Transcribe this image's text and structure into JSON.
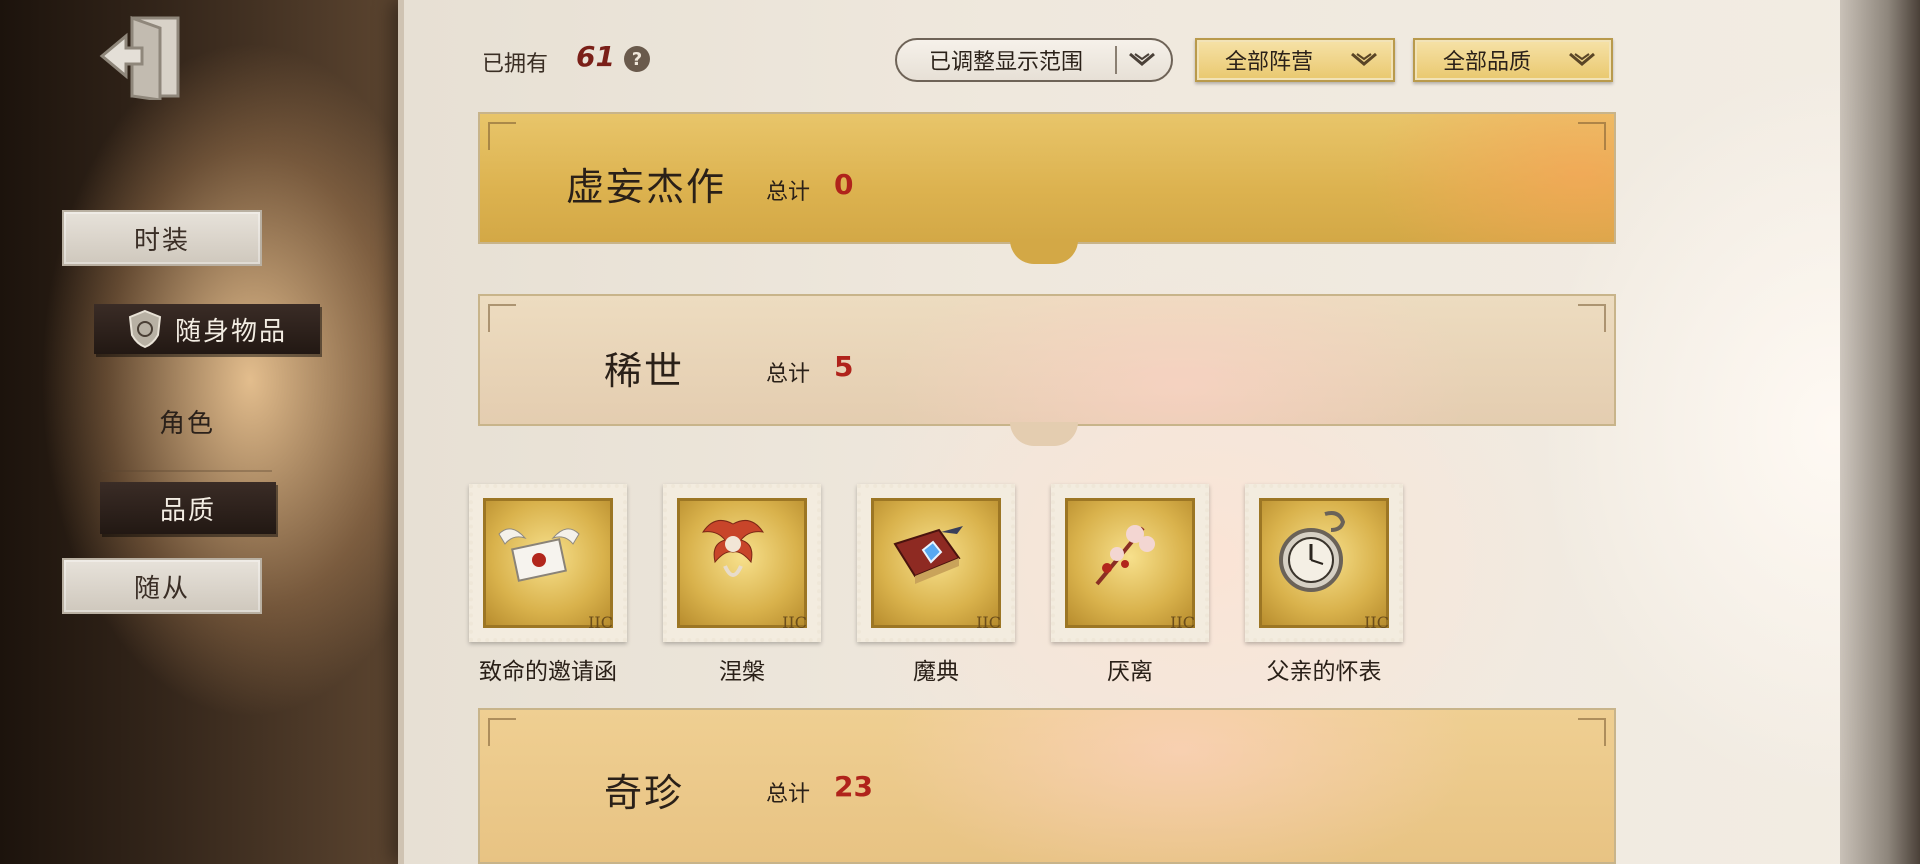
{
  "toolbar": {
    "owned_label": "已拥有",
    "owned_count": "61",
    "help": "?",
    "filter_range": "已调整显示范围",
    "filter_faction": "全部阵营",
    "filter_quality": "全部品质"
  },
  "sidebar": {
    "items": [
      {
        "label": "时装"
      },
      {
        "label": "随身物品"
      },
      {
        "label": "角色"
      },
      {
        "label": "品质"
      },
      {
        "label": "随从"
      }
    ]
  },
  "categories": [
    {
      "title": "虚妄杰作",
      "total_label": "总计",
      "total": "0"
    },
    {
      "title": "稀世",
      "total_label": "总计",
      "total": "5"
    },
    {
      "title": "奇珍",
      "total_label": "总计",
      "total": "23"
    }
  ],
  "items": [
    {
      "name": "致命的邀请函",
      "icon": "winged-letter-icon"
    },
    {
      "name": "涅槃",
      "icon": "phoenix-icon"
    },
    {
      "name": "魔典",
      "icon": "spellbook-icon"
    },
    {
      "name": "厌离",
      "icon": "blossom-branch-icon"
    },
    {
      "name": "父亲的怀表",
      "icon": "pocket-watch-icon"
    }
  ],
  "stamp_mark": "IIC"
}
